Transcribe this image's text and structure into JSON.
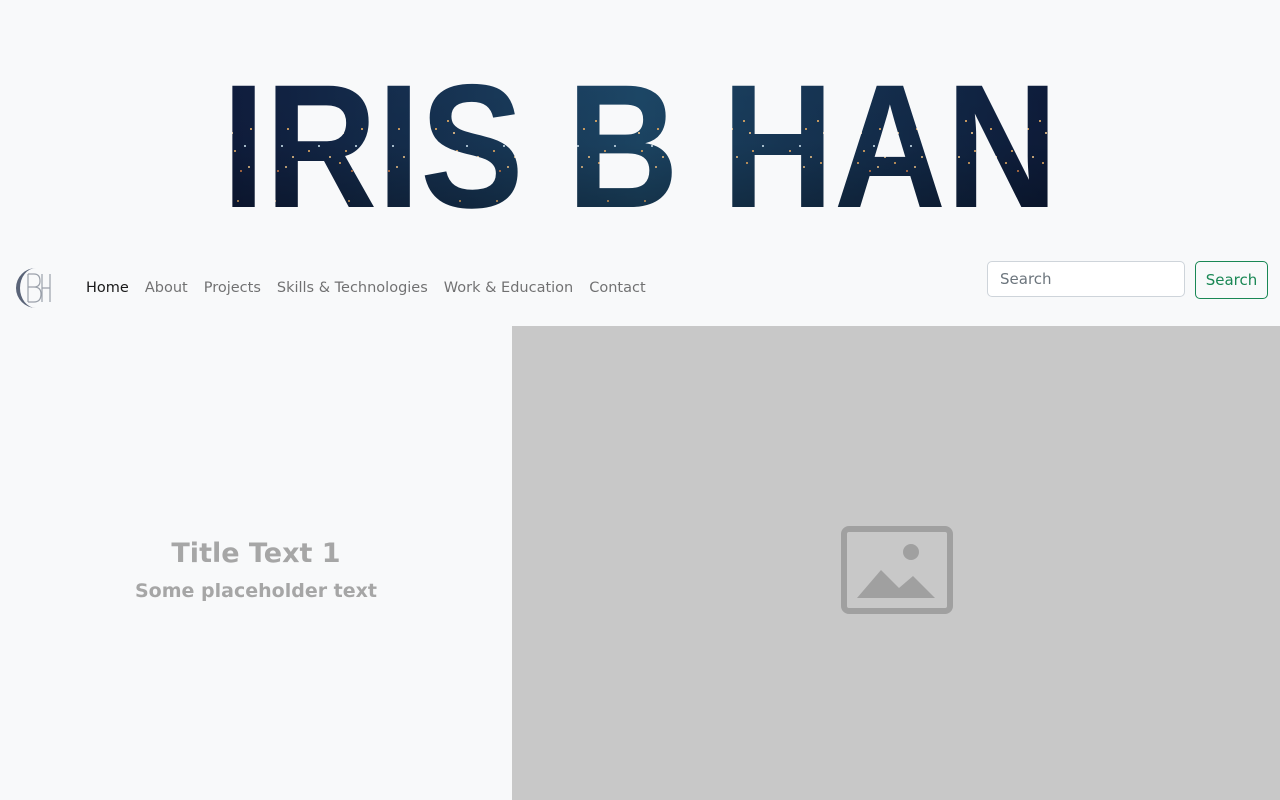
{
  "banner": {
    "title": "IRIS B HAN",
    "colors": {
      "sky_top": "#0f1b3d",
      "sky_mid": "#1e4a6b",
      "sky_dark": "#0d1a3a",
      "city_light": "#e8b06a"
    }
  },
  "brand": {
    "logo_icon": "bh-monogram-logo"
  },
  "nav": {
    "items": [
      {
        "label": "Home",
        "active": true
      },
      {
        "label": "About",
        "active": false
      },
      {
        "label": "Projects",
        "active": false
      },
      {
        "label": "Skills & Technologies",
        "active": false
      },
      {
        "label": "Work & Education",
        "active": false
      },
      {
        "label": "Contact",
        "active": false
      }
    ]
  },
  "search": {
    "placeholder": "Search",
    "value": "",
    "button_label": "Search",
    "button_color": "#198754"
  },
  "hero": {
    "title": "Title Text 1",
    "subtitle": "Some placeholder text",
    "image_icon": "image-placeholder-icon",
    "image_bg": "#c8c8c8"
  }
}
